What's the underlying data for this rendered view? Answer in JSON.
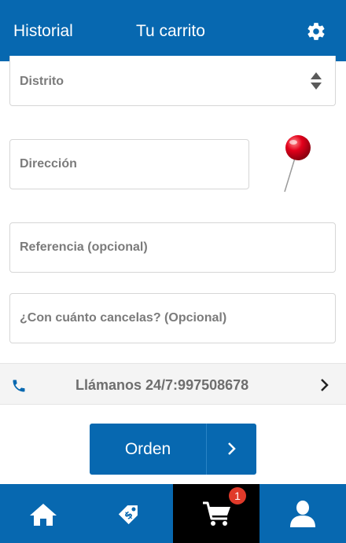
{
  "header": {
    "history_label": "Historial",
    "cart_label": "Tu carrito",
    "settings_icon": "gear-icon"
  },
  "form": {
    "district_placeholder": "Distrito",
    "address_placeholder": "Dirección",
    "reference_placeholder": "Referencia (opcional)",
    "cash_placeholder": "¿Con cuánto cancelas? (Opcional)"
  },
  "call_bar": {
    "text": "Llámanos 24/7:997508678",
    "icon": "phone-icon"
  },
  "order_button": {
    "label": "Orden"
  },
  "bottom_nav": {
    "items": [
      {
        "name": "home",
        "icon": "home-icon"
      },
      {
        "name": "promotions",
        "icon": "tag-icon"
      },
      {
        "name": "cart",
        "icon": "cart-icon",
        "badge": "1"
      },
      {
        "name": "profile",
        "icon": "user-icon"
      }
    ]
  },
  "colors": {
    "primary": "#0768b0",
    "active_nav": "#000000",
    "badge": "#e03a2a",
    "pin": "#e3001b"
  }
}
